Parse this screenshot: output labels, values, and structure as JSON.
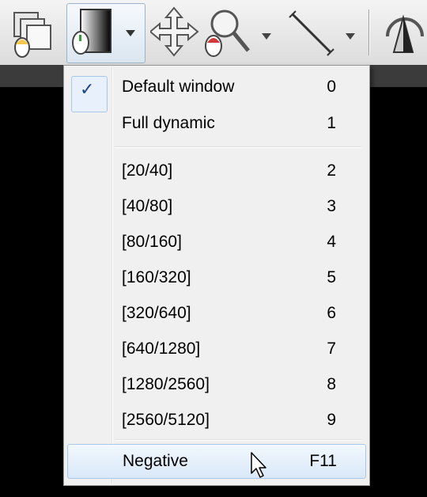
{
  "toolbar": {
    "icons": [
      "layers-icon",
      "window-level-icon",
      "dropdown-arrow-icon",
      "pan-icon",
      "zoom-icon",
      "dropdown-arrow-icon",
      "measure-line-icon",
      "dropdown-arrow-icon",
      "rotate-3d-icon"
    ]
  },
  "menu": {
    "items": [
      {
        "label": "Default window",
        "key": "0",
        "checked": true
      },
      {
        "label": "Full dynamic",
        "key": "1"
      },
      {
        "label": "[20/40]",
        "key": "2"
      },
      {
        "label": "[40/80]",
        "key": "3"
      },
      {
        "label": "[80/160]",
        "key": "4"
      },
      {
        "label": "[160/320]",
        "key": "5"
      },
      {
        "label": "[320/640]",
        "key": "6"
      },
      {
        "label": "[640/1280]",
        "key": "7"
      },
      {
        "label": "[1280/2560]",
        "key": "8"
      },
      {
        "label": "[2560/5120]",
        "key": "9"
      },
      {
        "label": "Negative",
        "key": "F11",
        "hover": true
      }
    ],
    "check_mark": "✓"
  },
  "colors": {
    "menu_bg": "#f0f0f0",
    "highlight_border": "#a8c8ea",
    "check_color": "#1b3f8f",
    "viewport_bg": "#000000"
  }
}
